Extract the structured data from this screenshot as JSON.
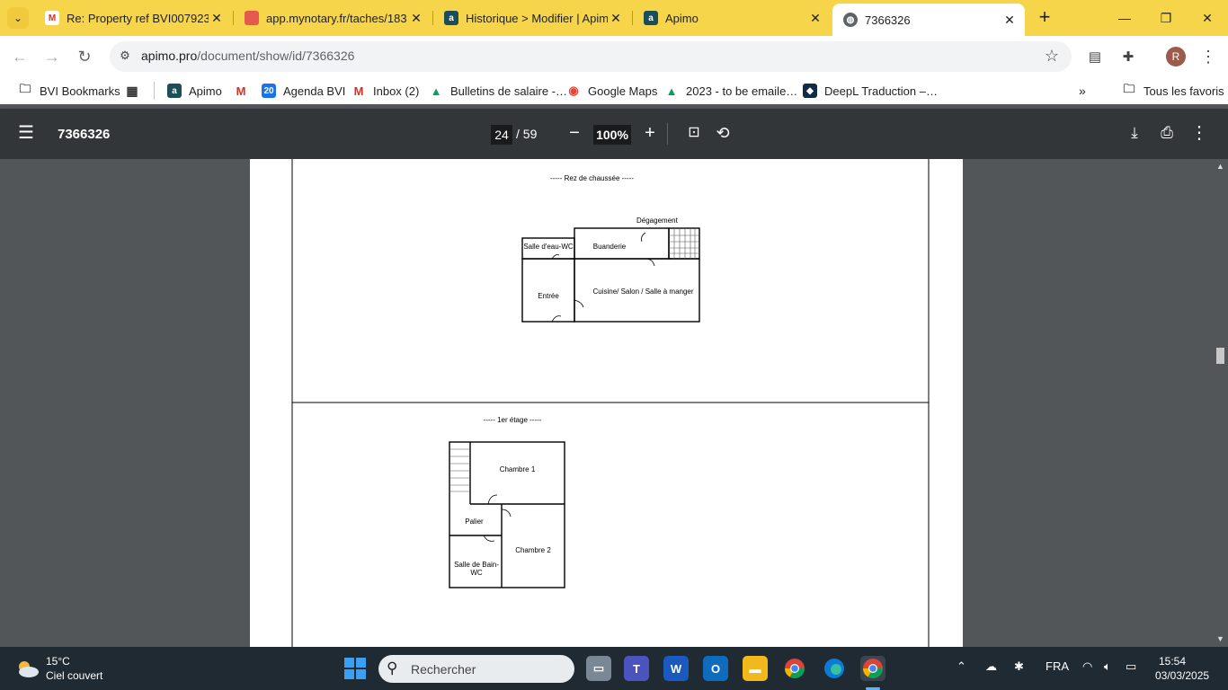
{
  "browser": {
    "tabs": [
      {
        "title": "Re: Property ref BVI0079238",
        "favicon": "gmail-icon",
        "active": false
      },
      {
        "title": "app.mynotary.fr/taches/183…",
        "favicon": "mynotary-icon",
        "active": false
      },
      {
        "title": "Historique > Modifier | Apimo",
        "favicon": "apimo-icon",
        "active": false
      },
      {
        "title": "Apimo",
        "favicon": "apimo-icon",
        "active": false
      },
      {
        "title": "7366326",
        "favicon": "globe-icon",
        "active": true
      }
    ],
    "url_host": "apimo.pro",
    "url_path": "/document/show/id/7366326",
    "profile_initial": "R",
    "bookmarks": [
      {
        "label": "BVI Bookmarks",
        "icon": "folder-bookmark-icon"
      },
      {
        "label": "",
        "icon": "apps-grid-icon"
      },
      {
        "label": "Apimo",
        "icon": "apimo-icon"
      },
      {
        "label": "",
        "icon": "gmail-icon"
      },
      {
        "label": "Agenda BVI",
        "icon": "calendar-icon"
      },
      {
        "label": "Inbox (2)",
        "icon": "gmail-icon"
      },
      {
        "label": "Bulletins de salaire -…",
        "icon": "google-drive-icon"
      },
      {
        "label": "Google Maps",
        "icon": "google-maps-icon"
      },
      {
        "label": "2023 - to be emaile…",
        "icon": "google-drive-icon"
      },
      {
        "label": "DeepL Traduction –…",
        "icon": "deepl-icon"
      }
    ],
    "all_bookmarks_label": "Tous les favoris"
  },
  "pdf": {
    "title": "7366326",
    "page_current": "24",
    "page_total": "/ 59",
    "zoom": "100%"
  },
  "floorplans": {
    "ground_title": "-----  Rez de chaussée  -----",
    "ground_rooms": {
      "degagement": "Dégagement",
      "salle_eau": "Salle d'eau-WC",
      "buanderie": "Buanderie",
      "entree": "Entrée",
      "cuisine": "Cuisine/ Salon / Salle à manger"
    },
    "first_title": "-----  1er étage  -----",
    "first_rooms": {
      "chambre1": "Chambre 1",
      "palier": "Palier",
      "salle_bain": "Salle de Bain-WC",
      "chambre2": "Chambre 2"
    }
  },
  "taskbar": {
    "temperature": "15°C",
    "weather": "Ciel couvert",
    "search_placeholder": "Rechercher",
    "language": "FRA",
    "time": "15:54",
    "date": "03/03/2025"
  },
  "colors": {
    "tabstrip": "#f6d54a",
    "pdf_toolbar": "#323639",
    "pdf_background": "#525659",
    "taskbar": "#1f2a33"
  }
}
